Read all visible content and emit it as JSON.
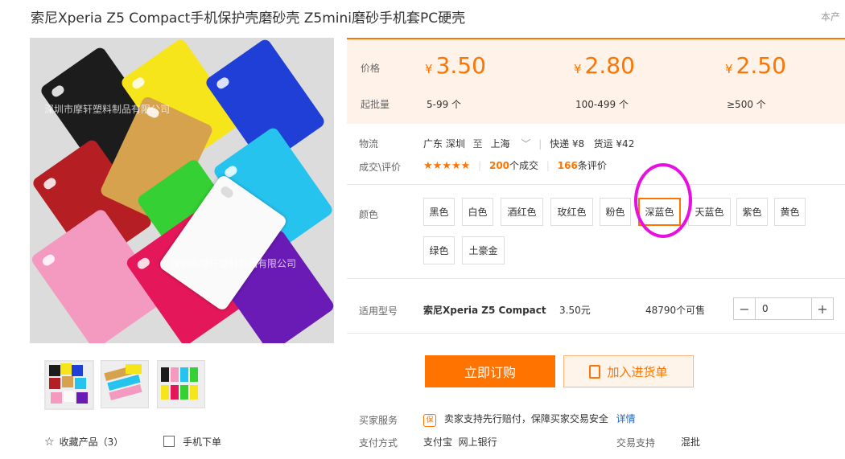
{
  "product": {
    "title": "索尼Xperia Z5 Compact手机保护壳磨砂壳 Z5mini磨砂手机套PC硬壳",
    "top_right": "本产",
    "watermark": "深圳市摩轩塑料制品有限公司"
  },
  "pricing": {
    "price_label": "价格",
    "qty_label": "起批量",
    "tiers": [
      {
        "currency": "¥",
        "price": "3.50",
        "range": "5-99 个"
      },
      {
        "currency": "¥",
        "price": "2.80",
        "range": "100-499 个"
      },
      {
        "currency": "¥",
        "price": "2.50",
        "range": "≥500 个"
      }
    ]
  },
  "logistics": {
    "label": "物流",
    "from": "广东 深圳",
    "to_word": "至",
    "to": "上海",
    "express": "快递 ¥8",
    "freight": "货运 ¥42"
  },
  "deals": {
    "label": "成交\\评价",
    "stars": "★★★★★",
    "count": "200",
    "count_suffix": "个成交",
    "reviews": "166",
    "reviews_suffix": "条评价"
  },
  "colors": {
    "label": "颜色",
    "options": [
      "黑色",
      "白色",
      "酒红色",
      "玫红色",
      "粉色",
      "深蓝色",
      "天蓝色",
      "紫色",
      "黄色",
      "绿色",
      "土豪金"
    ],
    "selected": "深蓝色"
  },
  "model": {
    "label": "适用型号",
    "name": "索尼Xperia Z5 Compact",
    "price": "3.50元",
    "stock": "48790个可售",
    "quantity": "0"
  },
  "actions": {
    "buy": "立即订购",
    "cart": "加入进货单"
  },
  "service": {
    "label": "买家服务",
    "badge": "保",
    "text": "卖家支持先行赔付，保障买家交易安全",
    "link": "详情"
  },
  "payment": {
    "label": "支付方式",
    "methods": "支付宝  网上银行",
    "trade_label": "交易支持",
    "trade_value": "混批"
  },
  "left_links": {
    "favorite": "收藏产品（3）",
    "mobile": "手机下单"
  },
  "colors_hex": {
    "accent": "#ff7300",
    "highlight_circle": "#e80fe1"
  }
}
